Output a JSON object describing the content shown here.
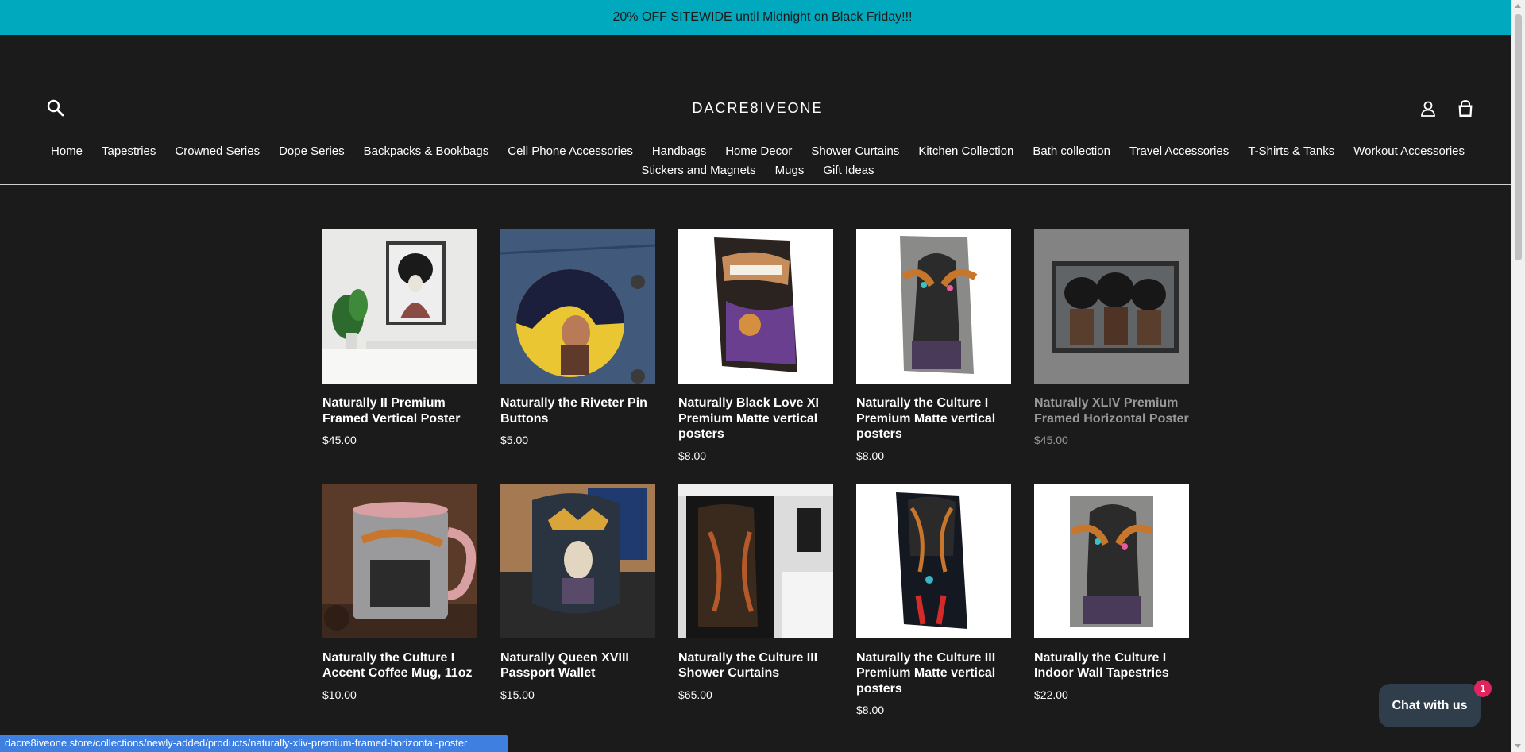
{
  "announcement": "20% OFF SITEWIDE until Midnight on Black Friday!!!",
  "header": {
    "store_name": "DACRE8IVEONE",
    "icons": {
      "search": "search-icon",
      "account": "user-icon",
      "cart": "cart-icon"
    }
  },
  "nav": {
    "items": [
      {
        "label": "Home"
      },
      {
        "label": "Tapestries"
      },
      {
        "label": "Crowned Series"
      },
      {
        "label": "Dope Series"
      },
      {
        "label": "Backpacks & Bookbags"
      },
      {
        "label": "Cell Phone Accessories"
      },
      {
        "label": "Handbags"
      },
      {
        "label": "Home Decor"
      },
      {
        "label": "Shower Curtains"
      },
      {
        "label": "Kitchen Collection"
      },
      {
        "label": "Bath collection"
      },
      {
        "label": "Travel Accessories"
      },
      {
        "label": "T-Shirts & Tanks"
      },
      {
        "label": "Workout Accessories"
      },
      {
        "label": "Stickers and Magnets"
      },
      {
        "label": "Mugs"
      },
      {
        "label": "Gift Ideas"
      }
    ]
  },
  "products": [
    {
      "title": "Naturally II Premium Framed Vertical Poster",
      "price": "$45.00",
      "image": "framed-poster-image"
    },
    {
      "title": "Naturally the Riveter Pin Buttons",
      "price": "$5.00",
      "image": "pin-button-image"
    },
    {
      "title": "Naturally Black Love XI Premium Matte vertical posters",
      "price": "$8.00",
      "image": "matte-poster-image"
    },
    {
      "title": "Naturally the Culture I Premium Matte vertical posters",
      "price": "$8.00",
      "image": "matte-poster-image"
    },
    {
      "title": "Naturally XLIV Premium Framed Horizontal Poster",
      "price": "$45.00",
      "image": "framed-poster-image"
    },
    {
      "title": "Naturally the Culture I Accent Coffee Mug, 11oz",
      "price": "$10.00",
      "image": "coffee-mug-image"
    },
    {
      "title": "Naturally Queen XVIII Passport Wallet",
      "price": "$15.00",
      "image": "passport-wallet-image"
    },
    {
      "title": "Naturally the Culture III Shower Curtains",
      "price": "$65.00",
      "image": "shower-curtain-image"
    },
    {
      "title": "Naturally the Culture III Premium Matte vertical posters",
      "price": "$8.00",
      "image": "matte-poster-image"
    },
    {
      "title": "Naturally the Culture I Indoor Wall Tapestries",
      "price": "$22.00",
      "image": "wall-tapestry-image"
    }
  ],
  "chat": {
    "label": "Chat with us",
    "badge": "1"
  },
  "status_url": "dacre8iveone.store/collections/newly-added/products/naturally-xliv-premium-framed-horizontal-poster",
  "colors": {
    "announcement_bg": "#00a9bd",
    "page_bg": "#1b1b1b",
    "chat_bg": "#2f3e4a",
    "badge": "#e0245e",
    "status_bg": "#3e7fe0"
  }
}
